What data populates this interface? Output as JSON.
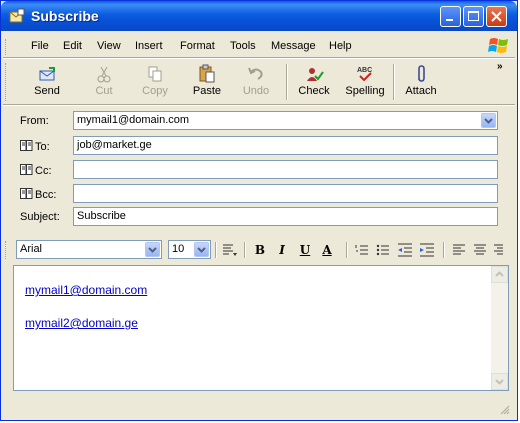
{
  "window": {
    "title": "Subscribe"
  },
  "menu": [
    "File",
    "Edit",
    "View",
    "Insert",
    "Format",
    "Tools",
    "Message",
    "Help"
  ],
  "toolbar": {
    "send": "Send",
    "cut": "Cut",
    "copy": "Copy",
    "paste": "Paste",
    "undo": "Undo",
    "check": "Check",
    "spelling": "Spelling",
    "attach": "Attach"
  },
  "header": {
    "from_label": "From:",
    "from_value": "mymail1@domain.com",
    "to_label": "To:",
    "to_value": "job@market.ge",
    "cc_label": "Cc:",
    "cc_value": "",
    "bcc_label": "Bcc:",
    "bcc_value": "",
    "subject_label": "Subject:",
    "subject_value": "Subscribe"
  },
  "format": {
    "font": "Arial",
    "size": "10",
    "bold": "B",
    "italic": "I",
    "underline": "U",
    "color": "A"
  },
  "body": {
    "link1": "mymail1@domain.com",
    "link2": "mymail2@domain.ge"
  },
  "colors": {
    "titlebar": "#0a58e8",
    "link": "#0000cc",
    "chrome": "#ece9d8"
  }
}
